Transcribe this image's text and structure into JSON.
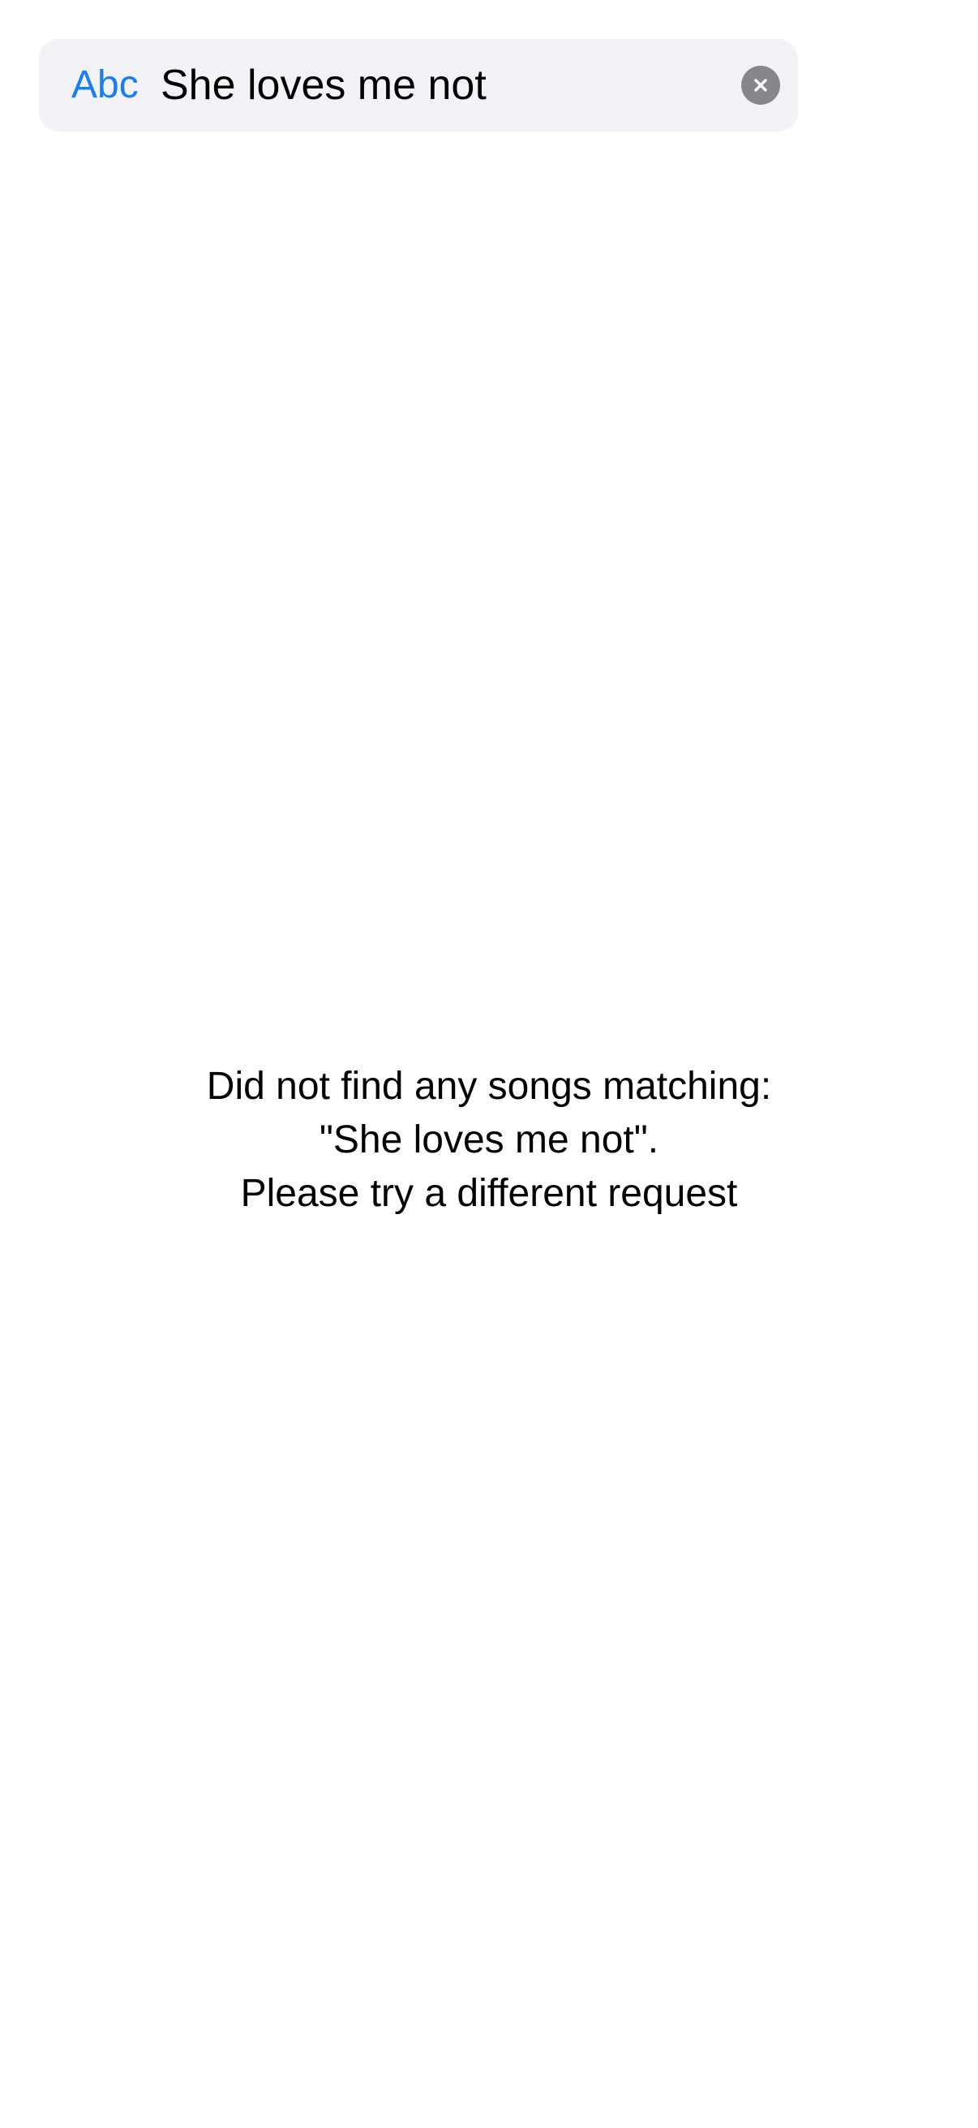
{
  "search": {
    "mode_label": "Abc",
    "value": "She loves me not",
    "clear_icon": "clear-icon"
  },
  "empty_state": {
    "line1": "Did not find any songs matching:",
    "line2": "\"She loves me not\".",
    "line3": "Please try a different request"
  },
  "colors": {
    "accent": "#1a7ef0",
    "search_background": "#f2f2f7",
    "clear_button": "#86868b"
  }
}
